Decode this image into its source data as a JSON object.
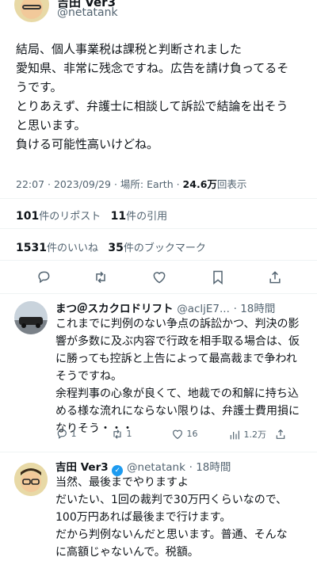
{
  "author": {
    "name": "吉田 Ver3",
    "handle": "@netatank"
  },
  "tweet": {
    "lines": [
      "結局、個人事業税は課税と判断されました",
      "愛知県、非常に残念ですね。広告を請け負ってるそ",
      "うです。",
      "とりあえず、弁護士に相談して訴訟で結論を出そう",
      "と思います。",
      "負ける可能性高いけどね。"
    ],
    "time": "22:07 · 2023/09/29 · 場所: Earth · ",
    "views": "24.6万",
    "views_label": "回表示"
  },
  "stats": {
    "reposts": "101",
    "reposts_label": "件のリポスト",
    "quotes": "11",
    "quotes_label": "件の引用",
    "likes": "1531",
    "likes_label": "件のいいね",
    "bookmarks": "35",
    "bookmarks_label": "件のブックマーク"
  },
  "icons": [
    "reply-icon",
    "repost-icon",
    "like-icon",
    "bookmark-icon",
    "share-icon"
  ],
  "replies": [
    {
      "name": "まつ＠スカクロドリフト",
      "handle": "@acljE7...",
      "time": "· 18時間",
      "lines": [
        "これまでに判例のない争点の訴訟かつ、判決の影",
        "響が多数に及ぶ内容で行政を相手取る場合は、仮",
        "に勝っても控訴と上告によって最高裁まで争われ",
        "そうですね。",
        "余程判事の心象が良くて、地裁での和解に持ち込",
        "める様な流れにならない限りは、弁護士費用損に",
        "なりそう・・・"
      ],
      "reply_count": "1",
      "repost_count": "1",
      "like_count": "16",
      "view_count": "1.2万"
    },
    {
      "name": "吉田 Ver3",
      "handle": "@netatank",
      "time": "· 18時間",
      "lines": [
        "当然、最後までやりますよ",
        "だいたい、1回の裁判で30万円くらいなので、",
        "100万円あれば最後まで行けます。",
        "だから判例ないんだと思います。普通、そんな",
        "に高額じゃないんで。税額。"
      ]
    }
  ],
  "colors": {
    "text": "#0f1419",
    "muted": "#536471",
    "blue": "#1d9bf0",
    "border": "#eff3f4"
  }
}
